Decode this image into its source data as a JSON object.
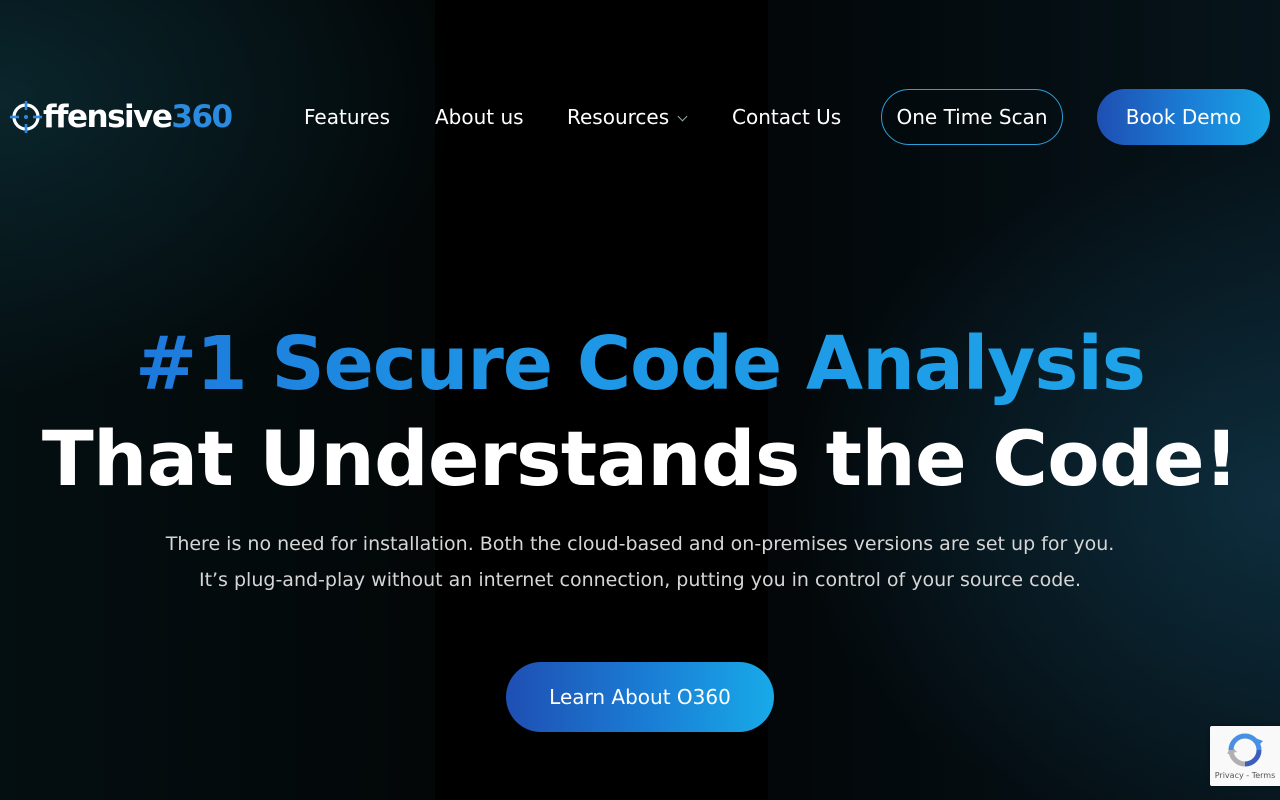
{
  "header": {
    "logo": {
      "text_white": "ffensive",
      "text_blue": "360",
      "icon": "crosshair-o-icon"
    },
    "nav": {
      "features": "Features",
      "about": "About us",
      "resources": "Resources",
      "contact": "Contact Us"
    },
    "one_time_scan": "One Time Scan",
    "book_demo": "Book Demo"
  },
  "hero": {
    "headline_line1": "#1 Secure Code Analysis",
    "headline_line2": "That Understands the Code!",
    "subtext_line1": "There is no need for installation. Both the cloud-based and on-premises versions are set up for you.",
    "subtext_line2": "It’s plug-and-play without an internet connection, putting you in control of your source code.",
    "cta": "Learn About O360"
  },
  "recaptcha": {
    "icon": "recaptcha-icon",
    "privacy": "Privacy",
    "separator": " - ",
    "terms": "Terms"
  },
  "colors": {
    "accent_blue": "#1e95e5",
    "button_gradient_start": "#1f4fb3",
    "button_gradient_end": "#18a6e6",
    "background": "#000000"
  }
}
